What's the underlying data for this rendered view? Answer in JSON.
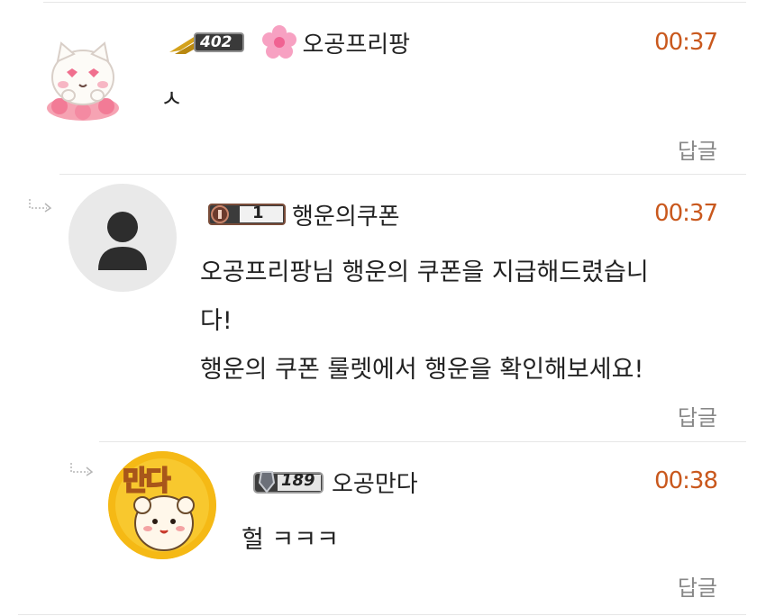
{
  "comments": [
    {
      "nickname": "오공프리팡",
      "time": "00:37",
      "level": "402",
      "text_lines": [
        "ㅅ"
      ],
      "reply_label": "답글",
      "avatar_icon": "cat-sticker-avatar"
    },
    {
      "nickname": "행운의쿠폰",
      "time": "00:37",
      "level": "1",
      "text_lines": [
        "오공프리팡님 행운의 쿠폰을 지급해드렸습니",
        "다!",
        "행운의 쿠폰 룰렛에서 행운을 확인해보세요!"
      ],
      "reply_label": "답글",
      "avatar_icon": "default-person-avatar"
    },
    {
      "nickname": "오공만다",
      "time": "00:38",
      "level": "189",
      "text_lines": [
        "헐 ㅋㅋㅋ"
      ],
      "reply_label": "답글",
      "avatar_icon": "manda-character-avatar",
      "avatar_text": "만다"
    }
  ],
  "colors": {
    "time": "#c9581d",
    "reply": "#888888",
    "divider": "#e6e6e6"
  }
}
